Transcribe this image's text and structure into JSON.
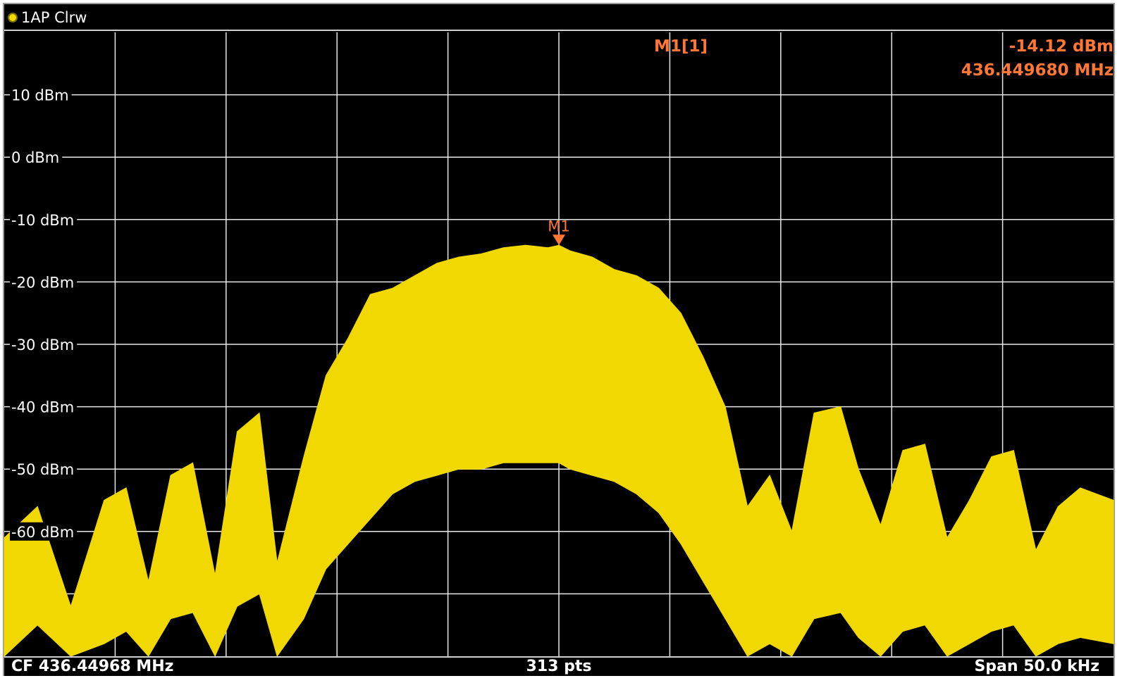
{
  "window": {
    "title": "1AP Clrw",
    "trace_color": "#f0d800",
    "marker_color": "#ff7733"
  },
  "marker_readout": {
    "name": "M1[1]",
    "level": "-14.12 dBm",
    "frequency": "436.449680 MHz"
  },
  "status": {
    "center_frequency": "CF 436.44968 MHz",
    "points": "313 pts",
    "span": "Span 50.0 kHz"
  },
  "chart_data": {
    "type": "line",
    "title": "",
    "xlabel": "",
    "ylabel": "",
    "center_frequency_mhz": 436.44968,
    "span_khz": 50.0,
    "points": 313,
    "xlim_khz": [
      -25,
      25
    ],
    "ylim_dbm": [
      -80,
      20
    ],
    "grid": true,
    "y_ticks": [
      {
        "value": 10,
        "label": "10 dBm"
      },
      {
        "value": 0,
        "label": "0 dBm"
      },
      {
        "value": -10,
        "label": "-10 dBm"
      },
      {
        "value": -20,
        "label": "-20 dBm"
      },
      {
        "value": -30,
        "label": "-30 dBm"
      },
      {
        "value": -40,
        "label": "-40 dBm"
      },
      {
        "value": -50,
        "label": "-50 dBm"
      },
      {
        "value": -60,
        "label": "-60 dBm"
      }
    ],
    "x_gridlines": 10,
    "series": [
      {
        "x_khz": [
          -25,
          -23.5,
          -22,
          -20.5,
          -19.5,
          -18.5,
          -17.5,
          -16.5,
          -15.5,
          -14.5,
          -13.5,
          -12.7,
          -11.5,
          -10.5,
          -9.5,
          -8.5,
          -7.5,
          -6.5,
          -5.5,
          -4.5,
          -3.5,
          -2.5,
          -1.5,
          -0.5,
          0,
          0.5,
          1.5,
          2.5,
          3.5,
          4.5,
          5.5,
          6.5,
          7.5,
          8.5,
          9.5,
          10.5,
          11.5,
          12.7,
          13.5,
          14.5,
          15.5,
          16.5,
          17.5,
          18.5,
          19.5,
          20.5,
          21.5,
          22.5,
          23.5,
          25
        ],
        "upper_dbm": [
          -61,
          -56,
          -72,
          -55,
          -53,
          -68,
          -51,
          -49,
          -67,
          -44,
          -41,
          -65,
          -48,
          -35,
          -29,
          -22,
          -21,
          -19,
          -17,
          -16,
          -15.5,
          -14.5,
          -14.12,
          -14.5,
          -14.12,
          -15,
          -16,
          -18,
          -19,
          -21,
          -25,
          -32,
          -40,
          -56,
          -51,
          -60,
          -41,
          -40,
          -50,
          -59,
          -47,
          -46,
          -61,
          -55,
          -48,
          -47,
          -63,
          -56,
          -53,
          -55
        ],
        "lower_dbm": [
          -80,
          -75,
          -80,
          -78,
          -76,
          -80,
          -74,
          -73,
          -80,
          -72,
          -70,
          -80,
          -74,
          -66,
          -62,
          -58,
          -54,
          -52,
          -51,
          -50,
          -50,
          -49,
          -49,
          -49,
          -49,
          -50,
          -51,
          -52,
          -54,
          -57,
          -62,
          -68,
          -74,
          -80,
          -78,
          -80,
          -74,
          -73,
          -77,
          -80,
          -76,
          -75,
          -80,
          -78,
          -76,
          -75,
          -80,
          -78,
          -77,
          -78
        ]
      }
    ],
    "markers": [
      {
        "label": "M1",
        "x_khz": 0,
        "y_dbm": -14.12
      }
    ]
  }
}
